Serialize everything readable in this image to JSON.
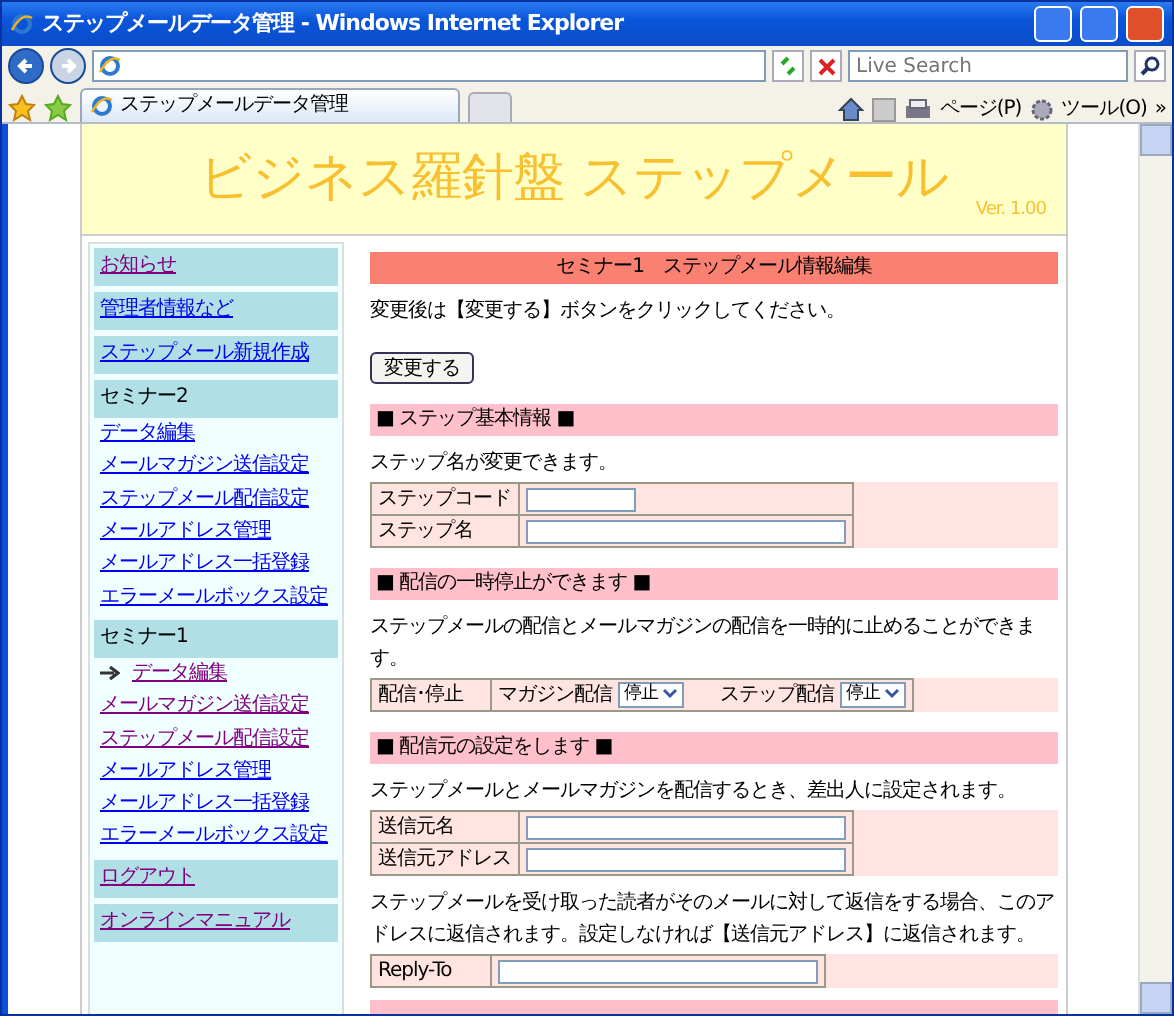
{
  "window": {
    "title": "ステップメールデータ管理 - Windows Internet Explorer"
  },
  "browser": {
    "search_placeholder": "Live Search",
    "tab_label": "ステップメールデータ管理",
    "page_menu": "ページ(P)",
    "tools_menu": "ツール(O)",
    "overflow": "»"
  },
  "header": {
    "title": "ビジネス羅針盤 ステップメール",
    "version": "Ver. 1.00"
  },
  "sidebar": [
    {
      "kind": "box",
      "label": "お知らせ",
      "visited": true
    },
    {
      "kind": "box",
      "label": "管理者情報など",
      "visited": false
    },
    {
      "kind": "box",
      "label": "ステップメール新規作成",
      "visited": false
    },
    {
      "kind": "group",
      "label": "セミナー2",
      "children": [
        {
          "label": "データ編集",
          "visited": false,
          "current": false
        },
        {
          "label": "メールマガジン送信設定",
          "visited": false,
          "current": false
        },
        {
          "label": "ステップメール配信設定",
          "visited": false,
          "current": false
        },
        {
          "label": "メールアドレス管理",
          "visited": false,
          "current": false
        },
        {
          "label": "メールアドレス一括登録",
          "visited": false,
          "current": false
        },
        {
          "label": "エラーメールボックス設定",
          "visited": false,
          "current": false
        }
      ]
    },
    {
      "kind": "group",
      "label": "セミナー1",
      "children": [
        {
          "label": "データ編集",
          "visited": true,
          "current": true
        },
        {
          "label": "メールマガジン送信設定",
          "visited": true,
          "current": false
        },
        {
          "label": "ステップメール配信設定",
          "visited": true,
          "current": false
        },
        {
          "label": "メールアドレス管理",
          "visited": false,
          "current": false
        },
        {
          "label": "メールアドレス一括登録",
          "visited": false,
          "current": false
        },
        {
          "label": "エラーメールボックス設定",
          "visited": false,
          "current": false
        }
      ]
    },
    {
      "kind": "box",
      "label": "ログアウト",
      "visited": true
    },
    {
      "kind": "box",
      "label": "オンラインマニュアル",
      "visited": true
    }
  ],
  "main": {
    "title": "セミナー1　ステップメール情報編集",
    "note": "変更後は【変更する】ボタンをクリックしてください。",
    "button": "変更する",
    "sections": [
      {
        "title": "■ ステップ基本情報 ■",
        "blocks": [
          {
            "kind": "text",
            "text": "ステップ名が変更できます。"
          },
          {
            "kind": "table",
            "rows": [
              {
                "label": "ステップコード",
                "fields": [
                  {
                    "kind": "short-input"
                  }
                ]
              },
              {
                "label": "ステップ名",
                "fields": [
                  {
                    "kind": "input"
                  }
                ]
              }
            ]
          }
        ]
      },
      {
        "title": "■ 配信の一時停止ができます ■",
        "blocks": [
          {
            "kind": "text",
            "text": "ステップメールの配信とメールマガジンの配信を一時的に止めることができます。"
          },
          {
            "kind": "table",
            "rows": [
              {
                "label": "配信･停止",
                "fields": [
                  {
                    "kind": "select",
                    "label": "マガジン配信",
                    "value": "停止"
                  },
                  {
                    "kind": "select",
                    "label": "ステップ配信",
                    "value": "停止"
                  }
                ]
              }
            ]
          }
        ]
      },
      {
        "title": "■ 配信元の設定をします ■",
        "blocks": [
          {
            "kind": "text",
            "text": "ステップメールとメールマガジンを配信するとき、差出人に設定されます。"
          },
          {
            "kind": "table",
            "rows": [
              {
                "label": "送信元名",
                "fields": [
                  {
                    "kind": "input"
                  }
                ]
              },
              {
                "label": "送信元アドレス",
                "fields": [
                  {
                    "kind": "input"
                  }
                ]
              }
            ]
          },
          {
            "kind": "text",
            "text": "ステップメールを受け取った読者がそのメールに対して返信をする場合、このアドレスに返信されます。設定しなければ【送信元アドレス】に返信されます。"
          },
          {
            "kind": "table",
            "rows": [
              {
                "label": "Reply-To",
                "fields": [
                  {
                    "kind": "input"
                  }
                ]
              }
            ]
          }
        ]
      }
    ],
    "more_below": true
  }
}
